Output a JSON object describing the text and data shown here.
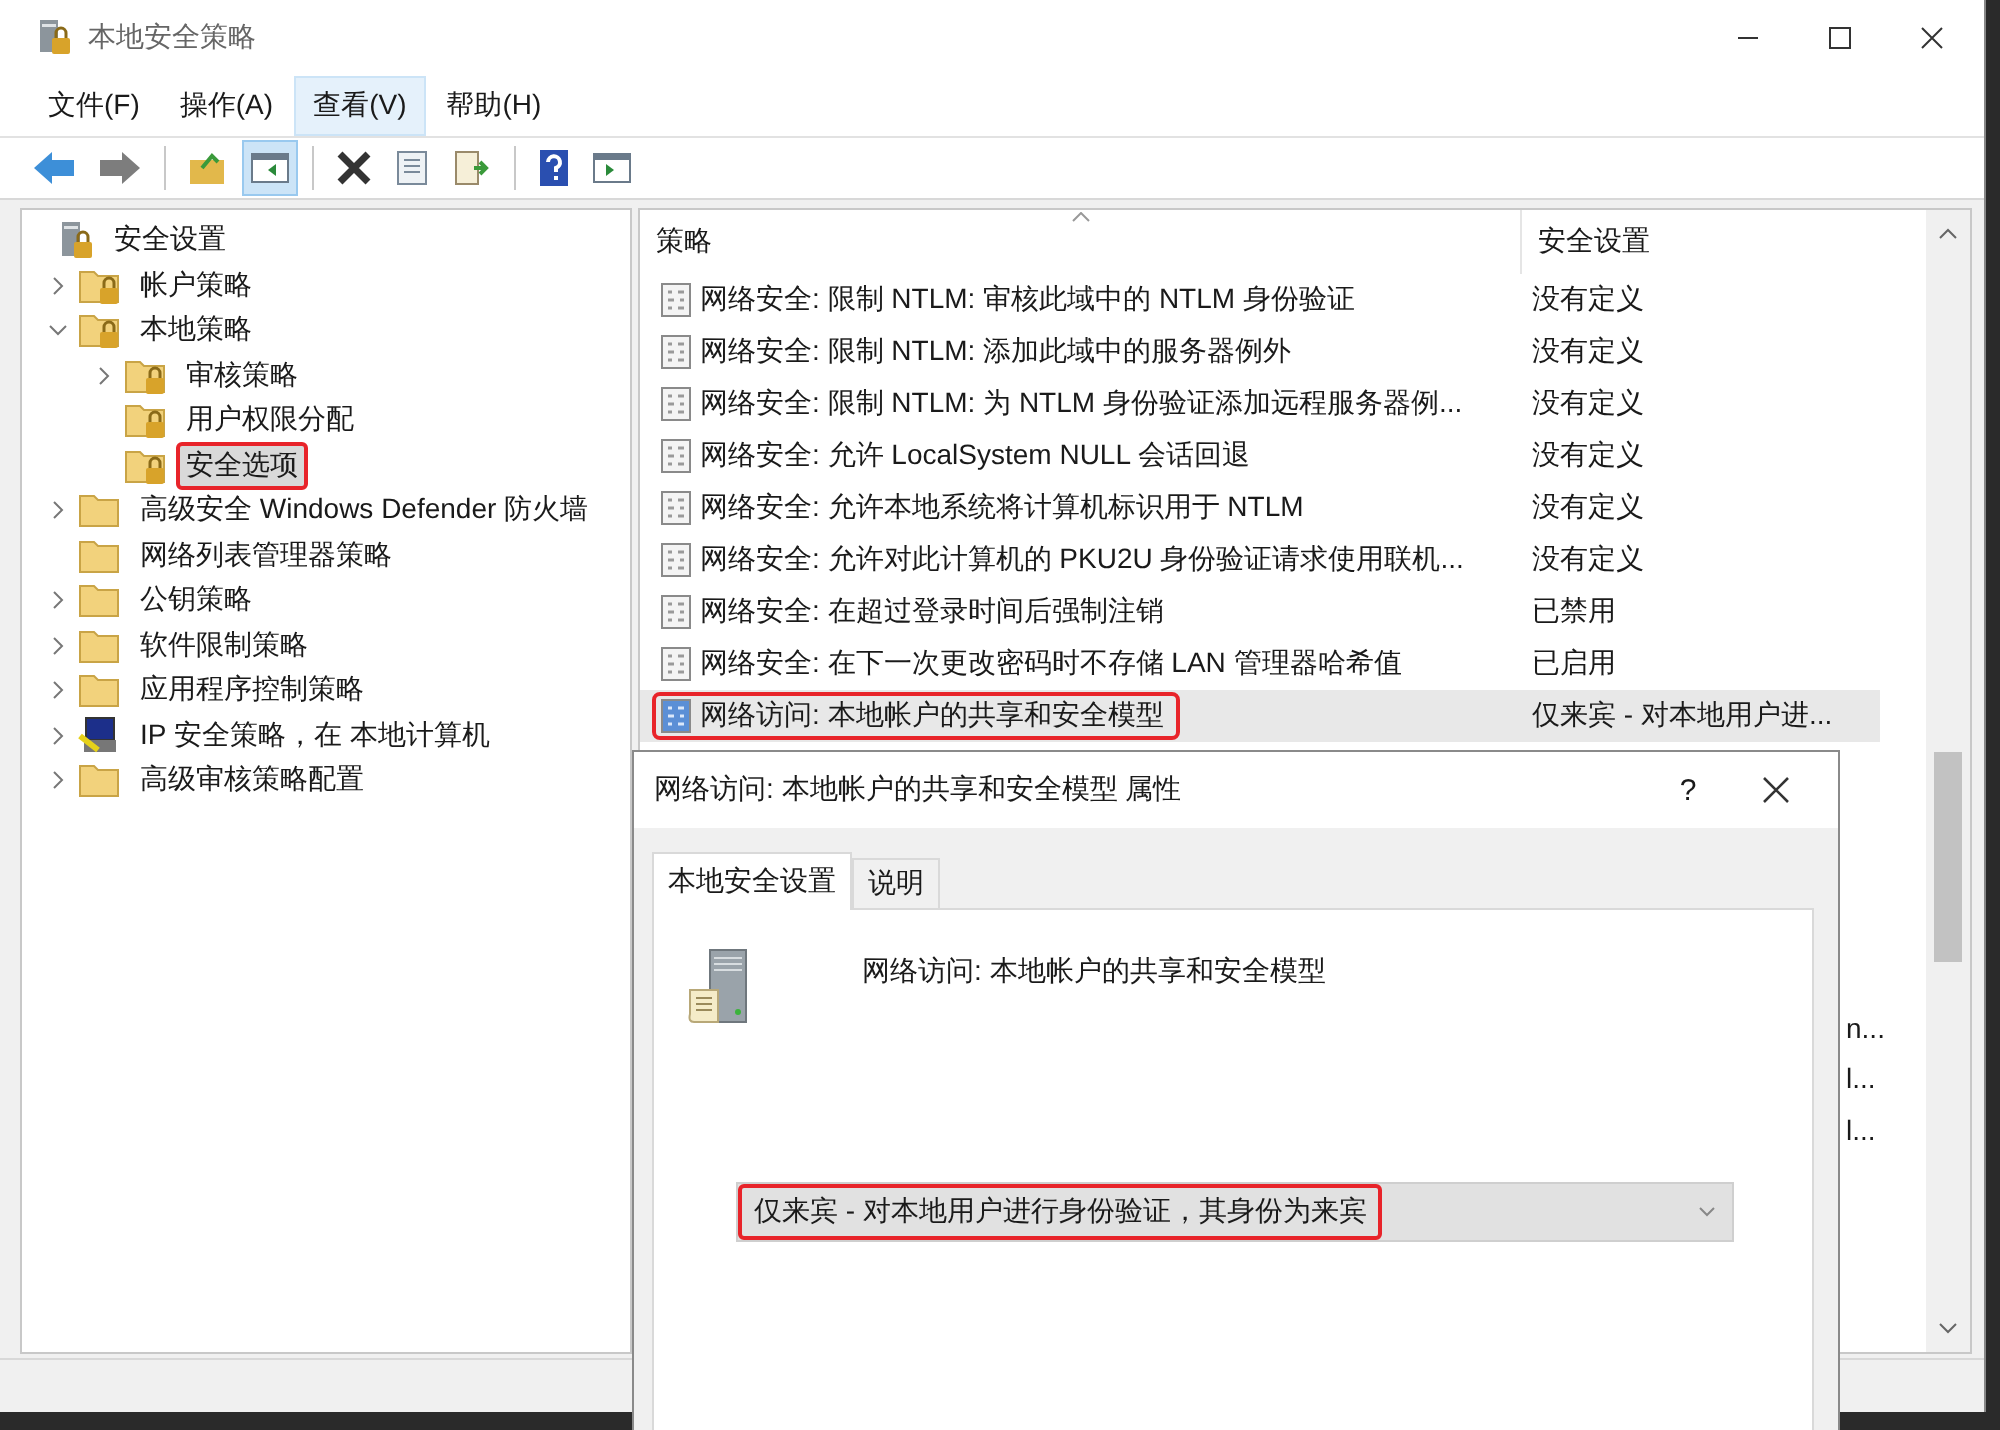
{
  "window": {
    "title": "本地安全策略"
  },
  "menu": [
    {
      "label": "文件(F)",
      "selected": false
    },
    {
      "label": "操作(A)",
      "selected": false
    },
    {
      "label": "查看(V)",
      "selected": true
    },
    {
      "label": "帮助(H)",
      "selected": false
    }
  ],
  "toolbar": [
    [
      {
        "kind": "back",
        "pressed": false
      },
      {
        "kind": "forward",
        "pressed": false
      }
    ],
    [
      {
        "kind": "up",
        "pressed": false
      },
      {
        "kind": "tree",
        "pressed": true
      }
    ],
    [
      {
        "kind": "delete",
        "pressed": false
      },
      {
        "kind": "properties",
        "pressed": false
      },
      {
        "kind": "export",
        "pressed": false
      }
    ],
    [
      {
        "kind": "help",
        "pressed": false
      },
      {
        "kind": "pane",
        "pressed": false
      }
    ]
  ],
  "tree": [
    {
      "label": "安全设置",
      "kind": "root",
      "expandable": false,
      "selected": false,
      "highlighted": false,
      "children": [
        {
          "label": "帐户策略",
          "kind": "lock",
          "expandable": true,
          "expanded": false,
          "selected": false,
          "highlighted": false
        },
        {
          "label": "本地策略",
          "kind": "lock",
          "expandable": true,
          "expanded": true,
          "selected": false,
          "highlighted": false,
          "children": [
            {
              "label": "审核策略",
              "kind": "lock",
              "expandable": true,
              "expanded": false,
              "selected": false,
              "highlighted": false
            },
            {
              "label": "用户权限分配",
              "kind": "lock",
              "expandable": false,
              "selected": false,
              "highlighted": false
            },
            {
              "label": "安全选项",
              "kind": "lock",
              "expandable": false,
              "selected": true,
              "highlighted": true
            }
          ]
        },
        {
          "label": "高级安全 Windows Defender 防火墙",
          "kind": "folder",
          "expandable": true,
          "expanded": false,
          "selected": false,
          "highlighted": false
        },
        {
          "label": "网络列表管理器策略",
          "kind": "folder",
          "expandable": false,
          "selected": false,
          "highlighted": false
        },
        {
          "label": "公钥策略",
          "kind": "folder",
          "expandable": true,
          "expanded": false,
          "selected": false,
          "highlighted": false
        },
        {
          "label": "软件限制策略",
          "kind": "folder",
          "expandable": true,
          "expanded": false,
          "selected": false,
          "highlighted": false
        },
        {
          "label": "应用程序控制策略",
          "kind": "folder",
          "expandable": true,
          "expanded": false,
          "selected": false,
          "highlighted": false
        },
        {
          "label": "IP 安全策略，在 本地计算机",
          "kind": "ip",
          "expandable": true,
          "expanded": false,
          "selected": false,
          "highlighted": false
        },
        {
          "label": "高级审核策略配置",
          "kind": "folder",
          "expandable": true,
          "expanded": false,
          "selected": false,
          "highlighted": false
        }
      ]
    }
  ],
  "table": {
    "columns": [
      "策略",
      "安全设置"
    ],
    "rows": [
      {
        "policy": "网络安全: 限制 NTLM: 审核此域中的 NTLM 身份验证",
        "setting": "没有定义",
        "selected": false,
        "highlighted": false
      },
      {
        "policy": "网络安全: 限制 NTLM: 添加此域中的服务器例外",
        "setting": "没有定义",
        "selected": false,
        "highlighted": false
      },
      {
        "policy": "网络安全: 限制 NTLM: 为 NTLM 身份验证添加远程服务器例...",
        "setting": "没有定义",
        "selected": false,
        "highlighted": false
      },
      {
        "policy": "网络安全: 允许 LocalSystem NULL 会话回退",
        "setting": "没有定义",
        "selected": false,
        "highlighted": false
      },
      {
        "policy": "网络安全: 允许本地系统将计算机标识用于 NTLM",
        "setting": "没有定义",
        "selected": false,
        "highlighted": false
      },
      {
        "policy": "网络安全: 允许对此计算机的 PKU2U 身份验证请求使用联机...",
        "setting": "没有定义",
        "selected": false,
        "highlighted": false
      },
      {
        "policy": "网络安全: 在超过登录时间后强制注销",
        "setting": "已禁用",
        "selected": false,
        "highlighted": false
      },
      {
        "policy": "网络安全: 在下一次更改密码时不存储 LAN 管理器哈希值",
        "setting": "已启用",
        "selected": false,
        "highlighted": false
      },
      {
        "policy": "网络访问: 本地帐户的共享和安全模型",
        "setting": "仅来宾 - 对本地用户进...",
        "selected": true,
        "highlighted": true
      }
    ],
    "covered_settings": [
      "n...",
      "l...",
      "l..."
    ]
  },
  "dialog": {
    "title": "网络访问: 本地帐户的共享和安全模型 属性",
    "help": "?",
    "tabs": [
      {
        "label": "本地安全设置",
        "selected": true
      },
      {
        "label": "说明",
        "selected": false
      }
    ],
    "policy_name": "网络访问: 本地帐户的共享和安全模型",
    "dropdown": {
      "value": "仅来宾 - 对本地用户进行身份验证，其身份为来宾",
      "highlighted": true
    }
  }
}
